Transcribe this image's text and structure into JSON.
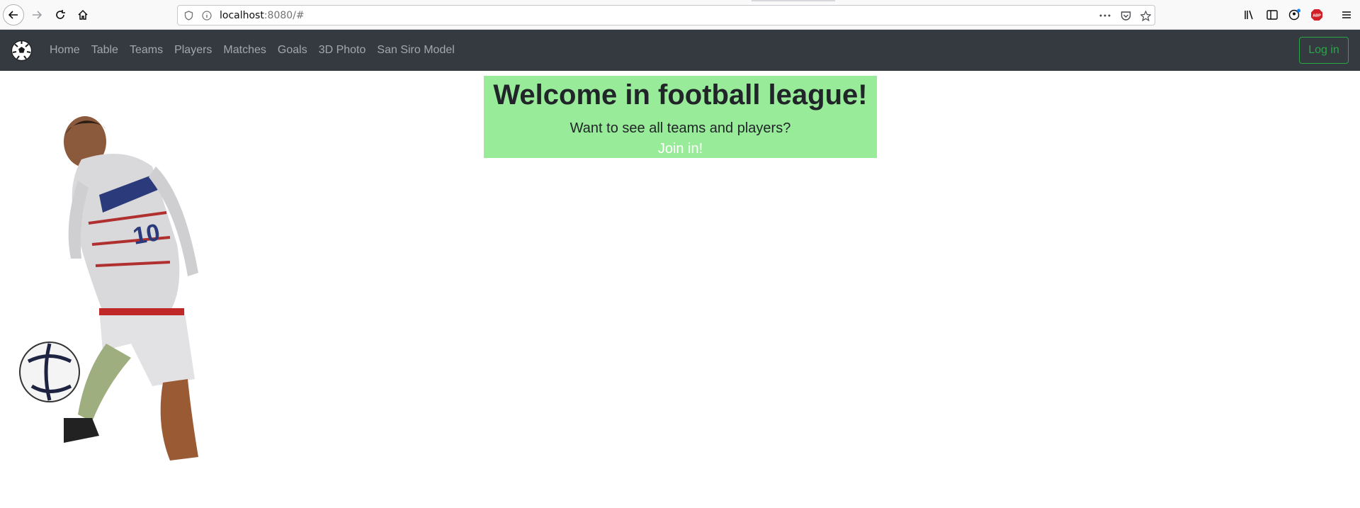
{
  "browser": {
    "url_host": "localhost",
    "url_rest": ":8080/#"
  },
  "navbar": {
    "items": [
      {
        "label": "Home"
      },
      {
        "label": "Table"
      },
      {
        "label": "Teams"
      },
      {
        "label": "Players"
      },
      {
        "label": "Matches"
      },
      {
        "label": "Goals"
      },
      {
        "label": "3D Photo"
      },
      {
        "label": "San Siro Model"
      }
    ],
    "login_label": "Log in",
    "login_color": "#28a745",
    "background": "#343a40"
  },
  "hero": {
    "title": "Welcome in football league!",
    "subtitle": "Want to see all teams and players?",
    "cta": "Join in!",
    "background": "#98eb98"
  },
  "icons": {
    "brand": "soccer-ball-icon",
    "player": "football-player-image"
  }
}
